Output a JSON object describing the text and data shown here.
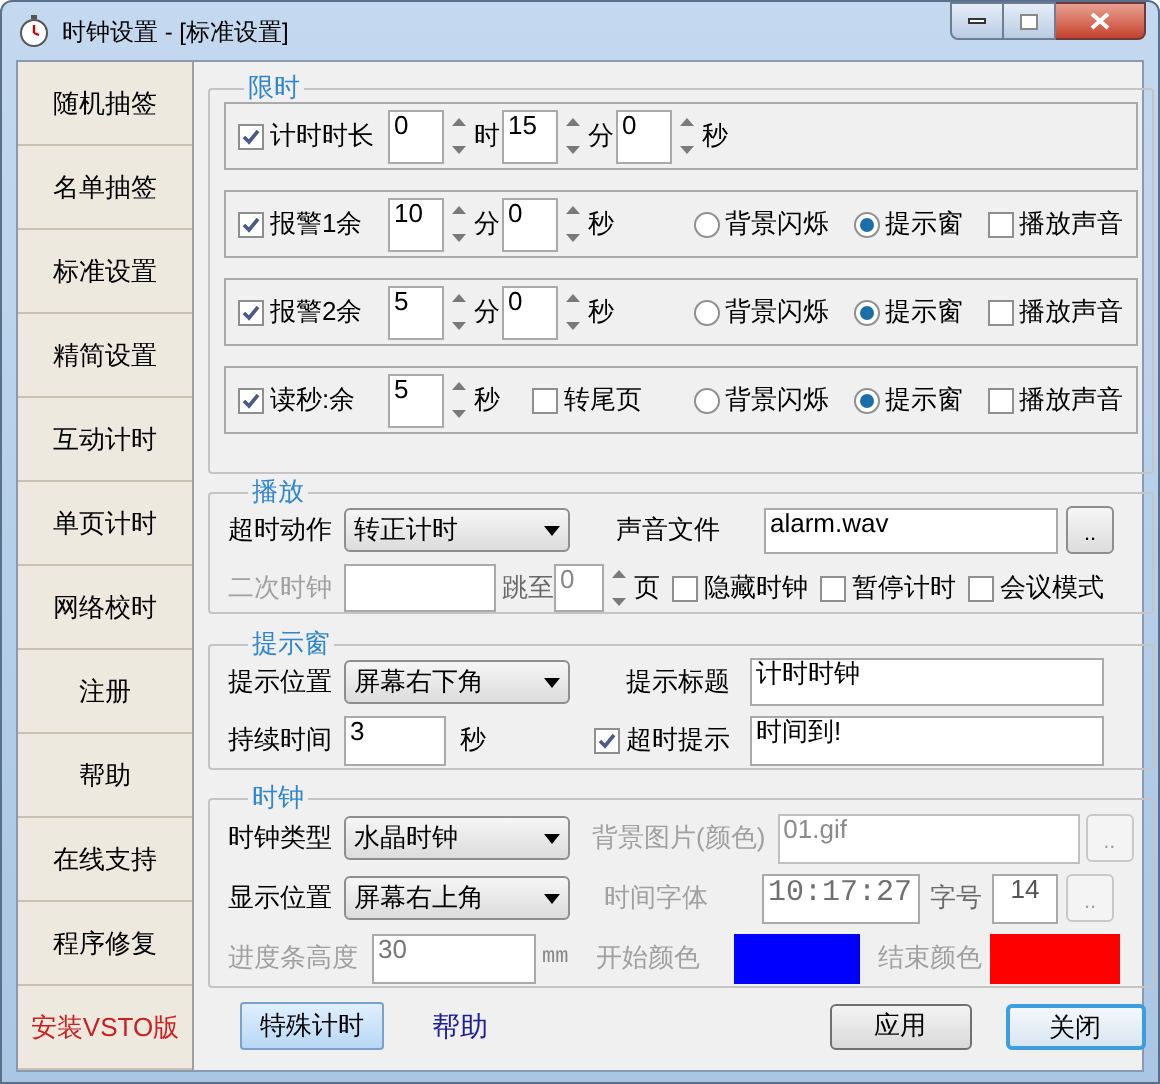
{
  "window": {
    "title": "时钟设置 - [标准设置]"
  },
  "sidebar": {
    "items": [
      {
        "label": "随机抽签",
        "color": "#000000"
      },
      {
        "label": "名单抽签",
        "color": "#000000"
      },
      {
        "label": "标准设置",
        "color": "#000000"
      },
      {
        "label": "精简设置",
        "color": "#000000"
      },
      {
        "label": "互动计时",
        "color": "#000000"
      },
      {
        "label": "单页计时",
        "color": "#000000"
      },
      {
        "label": "网络校时",
        "color": "#000000"
      },
      {
        "label": "注册",
        "color": "#000000"
      },
      {
        "label": "帮助",
        "color": "#000000"
      },
      {
        "label": "在线支持",
        "color": "#000000"
      },
      {
        "label": "程序修复",
        "color": "#000000"
      },
      {
        "label": "安装VSTO版",
        "color": "#cc2020"
      }
    ]
  },
  "limit_group": {
    "title": "限时",
    "rows": [
      {
        "kind": "duration",
        "checked": true,
        "label": "计时时长",
        "spinners": [
          {
            "value": "0",
            "unit": "时"
          },
          {
            "value": "15",
            "unit": "分"
          },
          {
            "value": "0",
            "unit": "秒"
          }
        ]
      },
      {
        "kind": "alert",
        "checked": true,
        "label": "报警1余",
        "spinners": [
          {
            "value": "10",
            "unit": "分"
          },
          {
            "value": "0",
            "unit": "秒"
          }
        ],
        "options": [
          {
            "label": "背景闪烁",
            "selected": false
          },
          {
            "label": "提示窗",
            "selected": true
          }
        ],
        "sound": {
          "label": "播放声音",
          "checked": false
        }
      },
      {
        "kind": "alert",
        "checked": true,
        "label": "报警2余",
        "spinners": [
          {
            "value": "5",
            "unit": "分"
          },
          {
            "value": "0",
            "unit": "秒"
          }
        ],
        "options": [
          {
            "label": "背景闪烁",
            "selected": false
          },
          {
            "label": "提示窗",
            "selected": true
          }
        ],
        "sound": {
          "label": "播放声音",
          "checked": false
        }
      },
      {
        "kind": "alert",
        "checked": true,
        "label": "读秒:余",
        "spinners": [
          {
            "value": "5",
            "unit": "秒"
          }
        ],
        "page_end": {
          "label": "转尾页",
          "checked": false
        },
        "options": [
          {
            "label": "背景闪烁",
            "selected": false
          },
          {
            "label": "提示窗",
            "selected": true
          }
        ],
        "sound": {
          "label": "播放声音",
          "checked": false
        }
      }
    ]
  },
  "playback_group": {
    "title": "播放",
    "timeout_action": {
      "label": "超时动作",
      "value": "转正计时"
    },
    "sound_file": {
      "label": "声音文件",
      "value": "alarm.wav",
      "button": ".."
    },
    "second_clock": {
      "label": "二次时钟",
      "disabled": true
    },
    "jump": {
      "label": "跳至",
      "value": "0",
      "unit": "页"
    },
    "checkboxes": [
      {
        "label": "隐藏时钟",
        "checked": false
      },
      {
        "label": "暂停计时",
        "checked": false
      },
      {
        "label": "会议模式",
        "checked": false
      }
    ]
  },
  "popup_group": {
    "title": "提示窗",
    "position": {
      "label": "提示位置",
      "value": "屏幕右下角"
    },
    "caption": {
      "label": "提示标题",
      "value": "计时时钟"
    },
    "duration": {
      "label": "持续时间",
      "value": "3",
      "unit": "秒"
    },
    "timeout_hint": {
      "label": "超时提示",
      "checked": true,
      "value": "时间到!"
    }
  },
  "clock_group": {
    "title": "时钟",
    "clock_type": {
      "label": "时钟类型",
      "value": "水晶时钟"
    },
    "background": {
      "label": "背景图片(颜色)",
      "value": "01.gif",
      "button": "..",
      "disabled": true
    },
    "display_position": {
      "label": "显示位置",
      "value": "屏幕右上角"
    },
    "time_font": {
      "label": "时间字体",
      "value": "10:17:27",
      "disabled": true
    },
    "font_size": {
      "label": "字号",
      "value": "14",
      "button": ".."
    },
    "progress_height": {
      "label": "进度条高度",
      "value": "30",
      "unit": "mm",
      "disabled": true
    },
    "start_color": {
      "label": "开始颜色",
      "color": "#0000ff"
    },
    "end_color": {
      "label": "结束颜色",
      "color": "#ff0000"
    }
  },
  "footer": {
    "special_button": "特殊计时",
    "help_link": "帮助",
    "apply_button": "应用",
    "close_button": "关闭"
  }
}
